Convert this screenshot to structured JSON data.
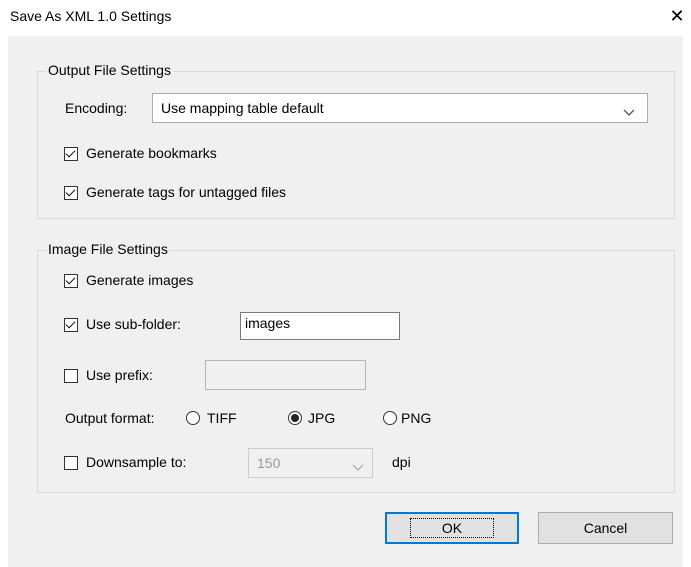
{
  "window": {
    "title": "Save As XML 1.0 Settings",
    "close_icon": "close-icon"
  },
  "output_group": {
    "legend": "Output File Settings",
    "encoding_label": "Encoding:",
    "encoding_value": "Use mapping table default",
    "generate_bookmarks": {
      "label": "Generate bookmarks",
      "checked": true
    },
    "generate_tags": {
      "label": "Generate tags for untagged files",
      "checked": true
    }
  },
  "image_group": {
    "legend": "Image File Settings",
    "generate_images": {
      "label": "Generate images",
      "checked": true
    },
    "use_subfolder": {
      "label": "Use sub-folder:",
      "checked": true,
      "value": "images"
    },
    "use_prefix": {
      "label": "Use prefix:",
      "checked": false,
      "value": ""
    },
    "output_format": {
      "label": "Output format:",
      "options": [
        "TIFF",
        "JPG",
        "PNG"
      ],
      "selected": "JPG"
    },
    "downsample": {
      "label": "Downsample to:",
      "checked": false,
      "value": "150",
      "unit": "dpi"
    }
  },
  "buttons": {
    "ok": "OK",
    "cancel": "Cancel"
  }
}
